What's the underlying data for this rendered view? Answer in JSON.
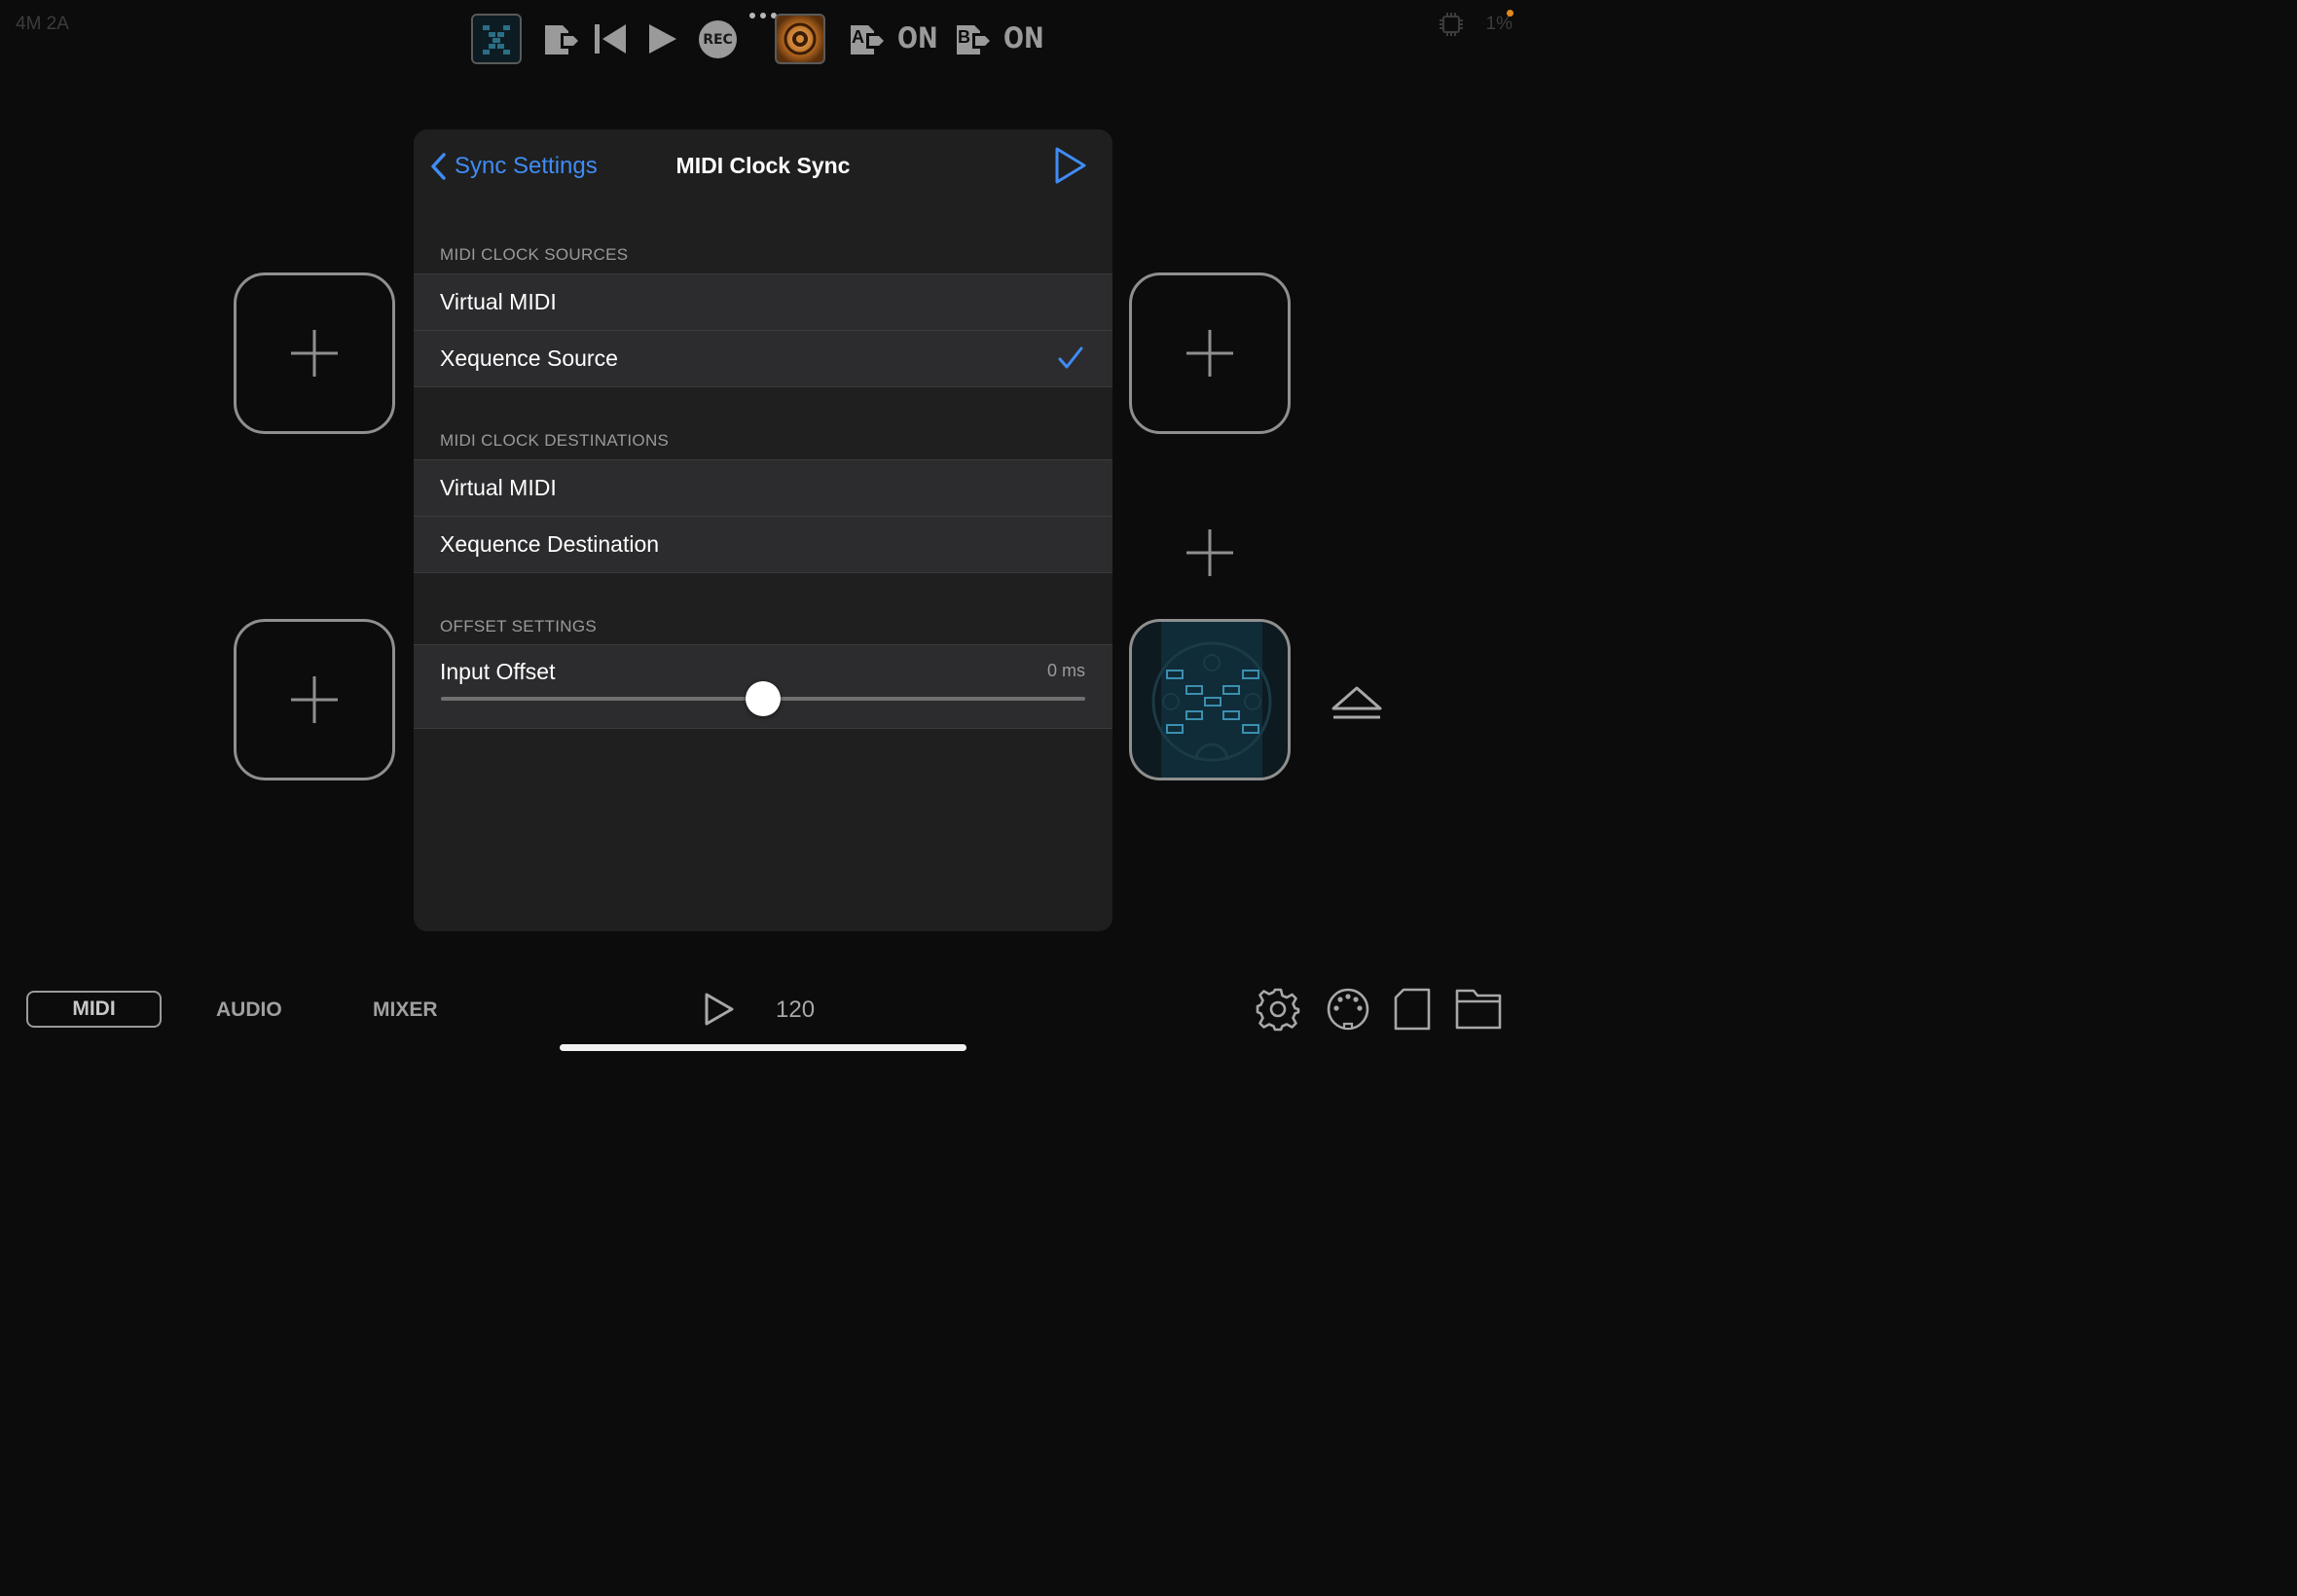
{
  "status": {
    "left": "4M 2A",
    "battery_pct": "1%"
  },
  "toolbar": {
    "rec_label": "REC",
    "a_letter": "A",
    "b_letter": "B",
    "a_state": "ON",
    "b_state": "ON"
  },
  "modal": {
    "back_label": "Sync Settings",
    "title": "MIDI Clock Sync",
    "sections": {
      "sources_header": "MIDI CLOCK SOURCES",
      "sources": [
        {
          "label": "Virtual MIDI",
          "checked": false
        },
        {
          "label": "Xequence Source",
          "checked": true
        }
      ],
      "destinations_header": "MIDI CLOCK DESTINATIONS",
      "destinations": [
        {
          "label": "Virtual MIDI"
        },
        {
          "label": "Xequence Destination"
        }
      ],
      "offset_header": "OFFSET SETTINGS",
      "offset": {
        "label": "Input Offset",
        "value_text": "0 ms",
        "value": 0,
        "min": -100,
        "max": 100
      }
    }
  },
  "bottom": {
    "tabs": [
      "MIDI",
      "AUDIO",
      "MIXER"
    ],
    "active_tab": "MIDI",
    "tempo": "120"
  },
  "colors": {
    "accent": "#3f8cf5",
    "row_bg": "#2c2c2e",
    "modal_bg": "#1f1f1f"
  }
}
